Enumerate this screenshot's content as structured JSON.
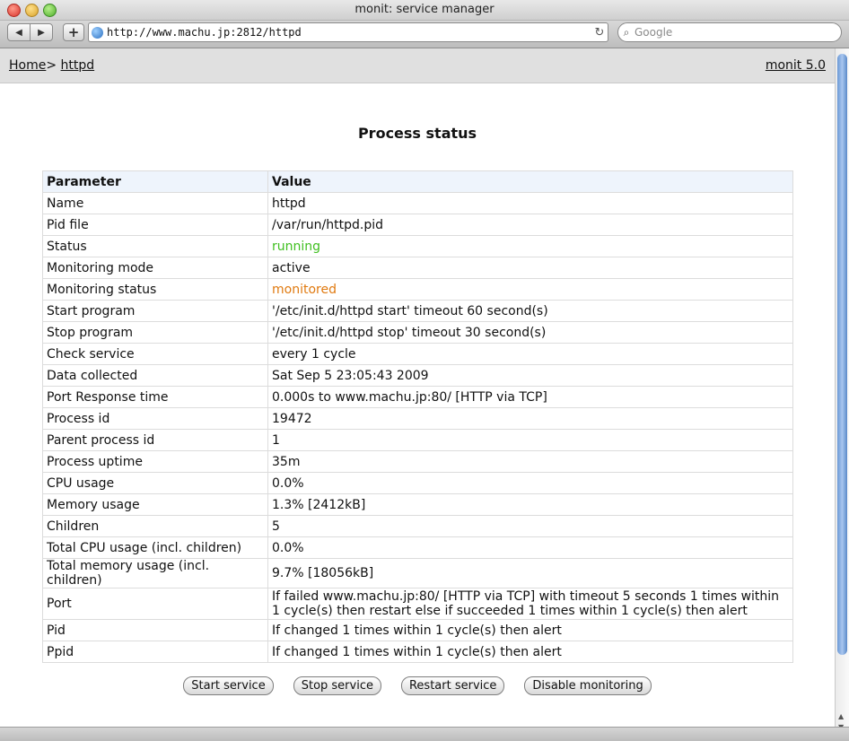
{
  "window": {
    "title": "monit: service manager"
  },
  "browser": {
    "url": "http://www.machu.jp:2812/httpd",
    "search_placeholder": "Google",
    "back_icon": "◀",
    "forward_icon": "▶",
    "add_icon": "+",
    "reload_icon": "↻",
    "search_icon": "⌕"
  },
  "header": {
    "home_label": "Home",
    "separator": ">",
    "current_label": "httpd",
    "version_label": "monit 5.0"
  },
  "page": {
    "title": "Process status"
  },
  "table": {
    "headers": [
      "Parameter",
      "Value"
    ],
    "rows": [
      {
        "param": "Name",
        "value": "httpd"
      },
      {
        "param": "Pid file",
        "value": "/var/run/httpd.pid"
      },
      {
        "param": "Status",
        "value": "running"
      },
      {
        "param": "Monitoring mode",
        "value": "active"
      },
      {
        "param": "Monitoring status",
        "value": "monitored"
      },
      {
        "param": "Start program",
        "value": "'/etc/init.d/httpd start' timeout 60 second(s)"
      },
      {
        "param": "Stop program",
        "value": "'/etc/init.d/httpd stop' timeout 30 second(s)"
      },
      {
        "param": "Check service",
        "value": "every 1 cycle"
      },
      {
        "param": "Data collected",
        "value": "Sat Sep 5 23:05:43 2009"
      },
      {
        "param": "Port Response time",
        "value": "0.000s to www.machu.jp:80/ [HTTP via TCP]"
      },
      {
        "param": "Process id",
        "value": "19472"
      },
      {
        "param": "Parent process id",
        "value": "1"
      },
      {
        "param": "Process uptime",
        "value": "35m"
      },
      {
        "param": "CPU usage",
        "value": "0.0%"
      },
      {
        "param": "Memory usage",
        "value": "1.3% [2412kB]"
      },
      {
        "param": "Children",
        "value": "5"
      },
      {
        "param": "Total CPU usage (incl. children)",
        "value": "0.0%"
      },
      {
        "param": "Total memory usage (incl. children)",
        "value": "9.7% [18056kB]"
      },
      {
        "param": "Port",
        "value": "If failed www.machu.jp:80/ [HTTP via TCP] with timeout 5 seconds 1 times within 1 cycle(s) then restart else if succeeded 1 times within 1 cycle(s) then alert"
      },
      {
        "param": "Pid",
        "value": "If changed 1 times within 1 cycle(s) then alert"
      },
      {
        "param": "Ppid",
        "value": "If changed 1 times within 1 cycle(s) then alert"
      }
    ]
  },
  "actions": {
    "start": "Start service",
    "stop": "Stop service",
    "restart": "Restart service",
    "disable": "Disable monitoring"
  },
  "colors": {
    "running": "#3fbf1f",
    "monitored": "#e07a10",
    "header_bg": "#eef4fc"
  }
}
